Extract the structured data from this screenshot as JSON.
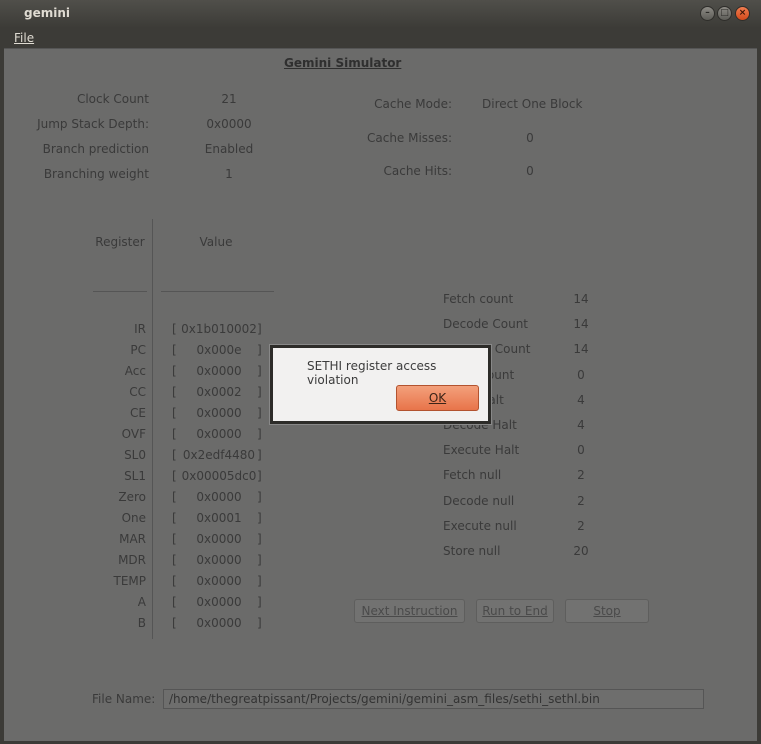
{
  "window": {
    "title": "gemini",
    "minimize": "–",
    "maximize": "□",
    "close": "×"
  },
  "menu": {
    "file": "File"
  },
  "simulator": {
    "title": "Gemini Simulator",
    "stats": [
      {
        "label": "Clock Count",
        "value": "21"
      },
      {
        "label": "Jump Stack Depth:",
        "value": "0x0000"
      },
      {
        "label": "Branch prediction",
        "value": "Enabled"
      },
      {
        "label": "Branching weight",
        "value": "1"
      }
    ],
    "cache": [
      {
        "label": "Cache Mode:",
        "value": "Direct One Block"
      },
      {
        "label": "Cache Misses:",
        "value": "0"
      },
      {
        "label": "Cache Hits:",
        "value": "0"
      }
    ],
    "register_header": "Register",
    "value_header": "Value",
    "registers": [
      {
        "name": "IR",
        "value": "0x1b010002"
      },
      {
        "name": "PC",
        "value": "0x000e"
      },
      {
        "name": "Acc",
        "value": "0x0000"
      },
      {
        "name": "CC",
        "value": "0x0002"
      },
      {
        "name": "CE",
        "value": "0x0000"
      },
      {
        "name": "OVF",
        "value": "0x0000"
      },
      {
        "name": "SL0",
        "value": "0x2edf4480"
      },
      {
        "name": "SL1",
        "value": "0x00005dc0"
      },
      {
        "name": "Zero",
        "value": "0x0000"
      },
      {
        "name": "One",
        "value": "0x0001"
      },
      {
        "name": "MAR",
        "value": "0x0000"
      },
      {
        "name": "MDR",
        "value": "0x0000"
      },
      {
        "name": "TEMP",
        "value": "0x0000"
      },
      {
        "name": "A",
        "value": "0x0000"
      },
      {
        "name": "B",
        "value": "0x0000"
      }
    ],
    "pipeline": [
      {
        "label": "Fetch count",
        "value": "14"
      },
      {
        "label": "Decode Count",
        "value": "14"
      },
      {
        "label": "Execute Count",
        "value": "14"
      },
      {
        "label": "Store Count",
        "value": "0"
      },
      {
        "label": "Fetch Halt",
        "value": "4"
      },
      {
        "label": "Decode Halt",
        "value": "4"
      },
      {
        "label": "Execute Halt",
        "value": "0"
      },
      {
        "label": "Fetch null",
        "value": "2"
      },
      {
        "label": "Decode null",
        "value": "2"
      },
      {
        "label": "Execute null",
        "value": "2"
      },
      {
        "label": "Store null",
        "value": "20"
      }
    ],
    "buttons": {
      "next": "Next Instruction",
      "run": "Run to End",
      "stop": "Stop"
    },
    "file_label": "File Name:",
    "file_path": "/home/thegreatpissant/Projects/gemini/gemini_asm_files/sethi_sethl.bin"
  },
  "dialog": {
    "message": "SETHI register access violation",
    "ok": "OK"
  }
}
